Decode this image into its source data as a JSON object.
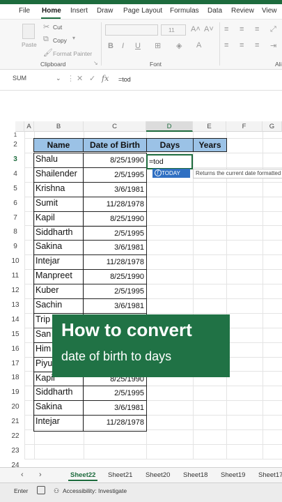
{
  "menu": {
    "items": [
      "File",
      "Home",
      "Insert",
      "Draw",
      "Page Layout",
      "Formulas",
      "Data",
      "Review",
      "View"
    ],
    "active": "Home"
  },
  "ribbon": {
    "paste_label": "Paste",
    "cut_label": "Cut",
    "copy_label": "Copy",
    "format_painter_label": "Format Painter",
    "font_size": "11",
    "bold_label": "B",
    "italic_label": "I",
    "underline_label": "U",
    "clipboard_group": "Clipboard",
    "font_group": "Font",
    "alignment_group_partial": "Ali"
  },
  "formula_bar": {
    "name_box": "SUM",
    "formula": "=tod"
  },
  "columns": [
    "A",
    "B",
    "C",
    "D",
    "E",
    "F",
    "G"
  ],
  "rows": [
    "1",
    "2",
    "3",
    "4",
    "5",
    "6",
    "7",
    "8",
    "9",
    "10",
    "11",
    "12",
    "13",
    "14",
    "15",
    "16",
    "17",
    "18",
    "19",
    "20",
    "21",
    "22",
    "23",
    "24"
  ],
  "table": {
    "headers": {
      "name": "Name",
      "dob": "Date of Birth",
      "days": "Days",
      "years": "Years"
    },
    "rows": [
      {
        "name": "Shalu",
        "dob": "8/25/1990"
      },
      {
        "name": "Shailender",
        "dob": "2/5/1995"
      },
      {
        "name": "Krishna",
        "dob": "3/6/1981"
      },
      {
        "name": "Sumit",
        "dob": "11/28/1978"
      },
      {
        "name": "Kapil",
        "dob": "8/25/1990"
      },
      {
        "name": "Siddharth",
        "dob": "2/5/1995"
      },
      {
        "name": "Sakina",
        "dob": "3/6/1981"
      },
      {
        "name": "Intejar",
        "dob": "11/28/1978"
      },
      {
        "name": "Manpreet",
        "dob": "8/25/1990"
      },
      {
        "name": "Kuber",
        "dob": "2/5/1995"
      },
      {
        "name": "Sachin",
        "dob": "3/6/1981"
      },
      {
        "name": "Trip",
        "dob": ""
      },
      {
        "name": "San",
        "dob": ""
      },
      {
        "name": "Him",
        "dob": ""
      },
      {
        "name": "Piyu",
        "dob": ""
      },
      {
        "name": "Kapil",
        "dob": "8/25/1990"
      },
      {
        "name": "Siddharth",
        "dob": "2/5/1995"
      },
      {
        "name": "Sakina",
        "dob": "3/6/1981"
      },
      {
        "name": "Intejar",
        "dob": "11/28/1978"
      }
    ]
  },
  "active_cell": {
    "value": "=tod",
    "suggestion": "TODAY",
    "tooltip": "Returns the current date formatted as a date."
  },
  "overlay": {
    "title": "How to convert",
    "subtitle": "date of birth to days"
  },
  "sheets": {
    "tabs": [
      "Sheet22",
      "Sheet21",
      "Sheet20",
      "Sheet18",
      "Sheet19",
      "Sheet17"
    ],
    "active": "Sheet22"
  },
  "status": {
    "mode": "Enter",
    "accessibility": "Accessibility: Investigate"
  },
  "colors": {
    "brand_green": "#1d6b3d",
    "header_fill": "#9bc2e6",
    "overlay_fill": "#207245",
    "suggestion_blue": "#2f6fc2"
  }
}
